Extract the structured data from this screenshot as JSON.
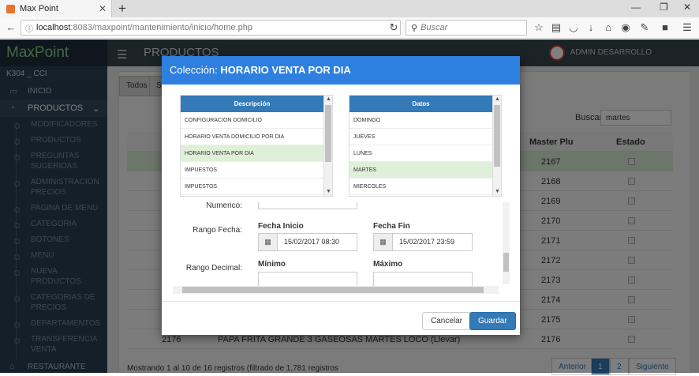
{
  "browser": {
    "tab_title": "Max Point",
    "url_host": "localhost",
    "url_rest": ":8083/maxpoint/mantenimiento/inicio/home.php",
    "search_placeholder": "Buscar"
  },
  "app": {
    "brand": "MaxPoint",
    "store": "K304 _ CCI",
    "page_title": "PRODUCTOS",
    "user": "ADMIN DESARROLLO",
    "sidebar": {
      "inicio": "INICIO",
      "productos": "PRODUCTOS",
      "restaurante": "RESTAURANTE",
      "subitems": [
        "MODIFICADORES",
        "PRODUCTOS",
        "PREGUNTAS SUGERIDAS",
        "ADMINISTRACION PRECIOS",
        "PAGINA DE MENU",
        "CATEGORIA",
        "BOTONES",
        "MENU",
        "NUEVA PRODUCTOS",
        "CATEGORIAS DE PRECIOS",
        "DEPARTAMENTOS",
        "TRANSFERENCIA VENTA"
      ]
    },
    "tabs": [
      "Todos",
      "S"
    ],
    "search_label": "Buscar:",
    "search_value": "martes",
    "table": {
      "headers": [
        "",
        "Master Plu",
        "Estado"
      ],
      "rows": [
        {
          "plu": "2167"
        },
        {
          "plu": "2168"
        },
        {
          "plu": "2169"
        },
        {
          "plu": "2170"
        },
        {
          "plu": "2171"
        },
        {
          "plu": "2172"
        },
        {
          "plu": "2173"
        },
        {
          "plu": "2174"
        },
        {
          "plu": "2175"
        }
      ],
      "last_row": {
        "id": "2176",
        "desc": "PAPA FRITA GRANDE 3 GASEOSAS MARTES LOCO (Llevar)",
        "plu": "2176"
      }
    },
    "footer_info": "Mostrando 1 al 10 de 16 registros (filtrado de 1,781 registros",
    "pager": {
      "prev": "Anterior",
      "p1": "1",
      "p2": "2",
      "next": "Siguiente"
    }
  },
  "modal": {
    "title_prefix": "Colección:",
    "title": "HORARIO VENTA POR DIA",
    "left_list": {
      "header": "Descripción",
      "items": [
        "CONFIGURACION DOMICILIO",
        "HORARIO VENTA DOMICILIO POR DIA",
        "HORARIO VENTA POR DIA",
        "IMPUESTOS",
        "IMPUESTOS"
      ],
      "selected": 2
    },
    "right_list": {
      "header": "Datos",
      "items": [
        "DOMINGO",
        "JUEVES",
        "LUNES",
        "MARTES",
        "MIERCOLES"
      ],
      "selected": 3
    },
    "form": {
      "numerico_label": "Numerico:",
      "rango_fecha_label": "Rango Fecha:",
      "fecha_inicio_label": "Fecha Inicio",
      "fecha_inicio": "15/02/2017 08:30",
      "fecha_fin_label": "Fecha Fin",
      "fecha_fin": "15/02/2017 23:59",
      "rango_decimal_label": "Rango Decimal:",
      "minimo_label": "Mínimo",
      "maximo_label": "Máximo"
    },
    "cancel": "Cancelar",
    "save": "Guardar"
  }
}
